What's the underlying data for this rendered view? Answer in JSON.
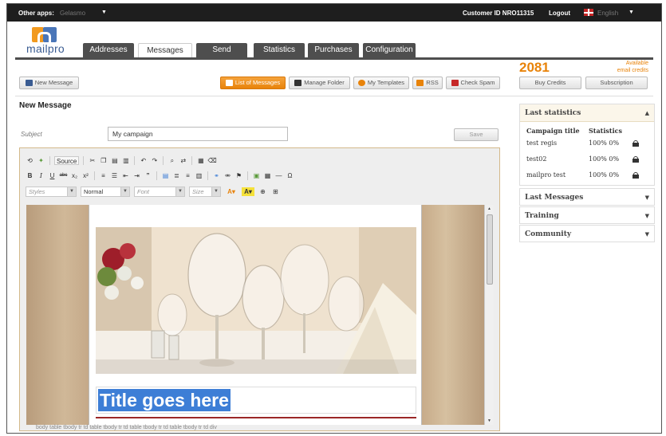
{
  "topbar": {
    "other_apps_label": "Other apps:",
    "other_apps_value": "Gelasmo",
    "customer_id": "Customer ID NRO11315",
    "logout": "Logout",
    "language": "English"
  },
  "logo": {
    "text": "mailpro"
  },
  "tabs": [
    {
      "label": "Addresses",
      "active": false
    },
    {
      "label": "Messages",
      "active": true
    },
    {
      "label": "Send",
      "active": false
    },
    {
      "label": "Statistics",
      "active": false
    },
    {
      "label": "Purchases",
      "active": false
    },
    {
      "label": "Configuration",
      "active": false
    }
  ],
  "credits": {
    "count": "2081",
    "available_line1": "Available",
    "available_line2": "email credits",
    "buy_credits": "Buy Credits",
    "subscription": "Subscription"
  },
  "toolbar": {
    "new_message": "New Message",
    "list_of_messages": "List of Messages",
    "manage_folder": "Manage Folder",
    "my_templates": "My Templates",
    "rss": "RSS",
    "check_spam": "Check Spam"
  },
  "form": {
    "heading": "New Message",
    "subject_label": "Subject",
    "subject_value": "My campaign",
    "save": "Save"
  },
  "editor": {
    "source_label": "Source",
    "styles_placeholder": "Styles",
    "format_value": "Normal",
    "font_placeholder": "Font",
    "size_placeholder": "Size",
    "content_title": "Title goes here",
    "path": "body  table  tbody  tr  td  table  tbody  tr  td  table  tbody  tr  td  table  tbody  tr  td  div"
  },
  "last_statistics": {
    "title": "Last statistics",
    "col_title": "Campaign title",
    "col_stats": "Statistics",
    "rows": [
      {
        "name": "test regis",
        "stats": "100%  0%"
      },
      {
        "name": "test02",
        "stats": "100%  0%"
      },
      {
        "name": "mailpro test",
        "stats": "100%  0%"
      }
    ]
  },
  "side_panels": {
    "last_messages": "Last Messages",
    "training": "Training",
    "community": "Community"
  },
  "colors": {
    "accent": "#e8830a",
    "tab_dark": "#4e4e4e",
    "brand_blue": "#3a5c92",
    "selection": "#3d7ed6"
  }
}
